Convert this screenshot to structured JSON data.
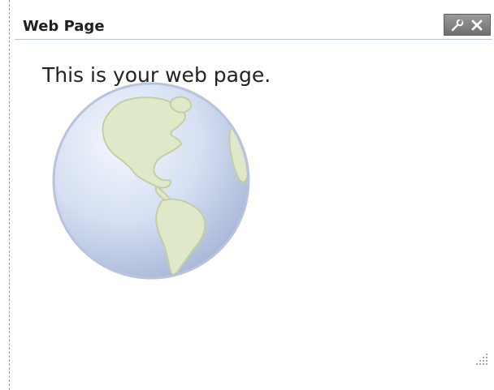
{
  "widget": {
    "title": "Web Page",
    "body_text": "This is your web page.",
    "controls": {
      "settings_icon": "wrench-icon",
      "close_icon": "close-icon"
    },
    "illustration": "globe-icon",
    "resize_handle": "resize-grip-icon"
  },
  "colors": {
    "header_rule": "#b7c3d6",
    "control_bg": "#7f7f7f",
    "globe_blue": "#c7d4ec",
    "globe_land": "#d8e3c0"
  }
}
